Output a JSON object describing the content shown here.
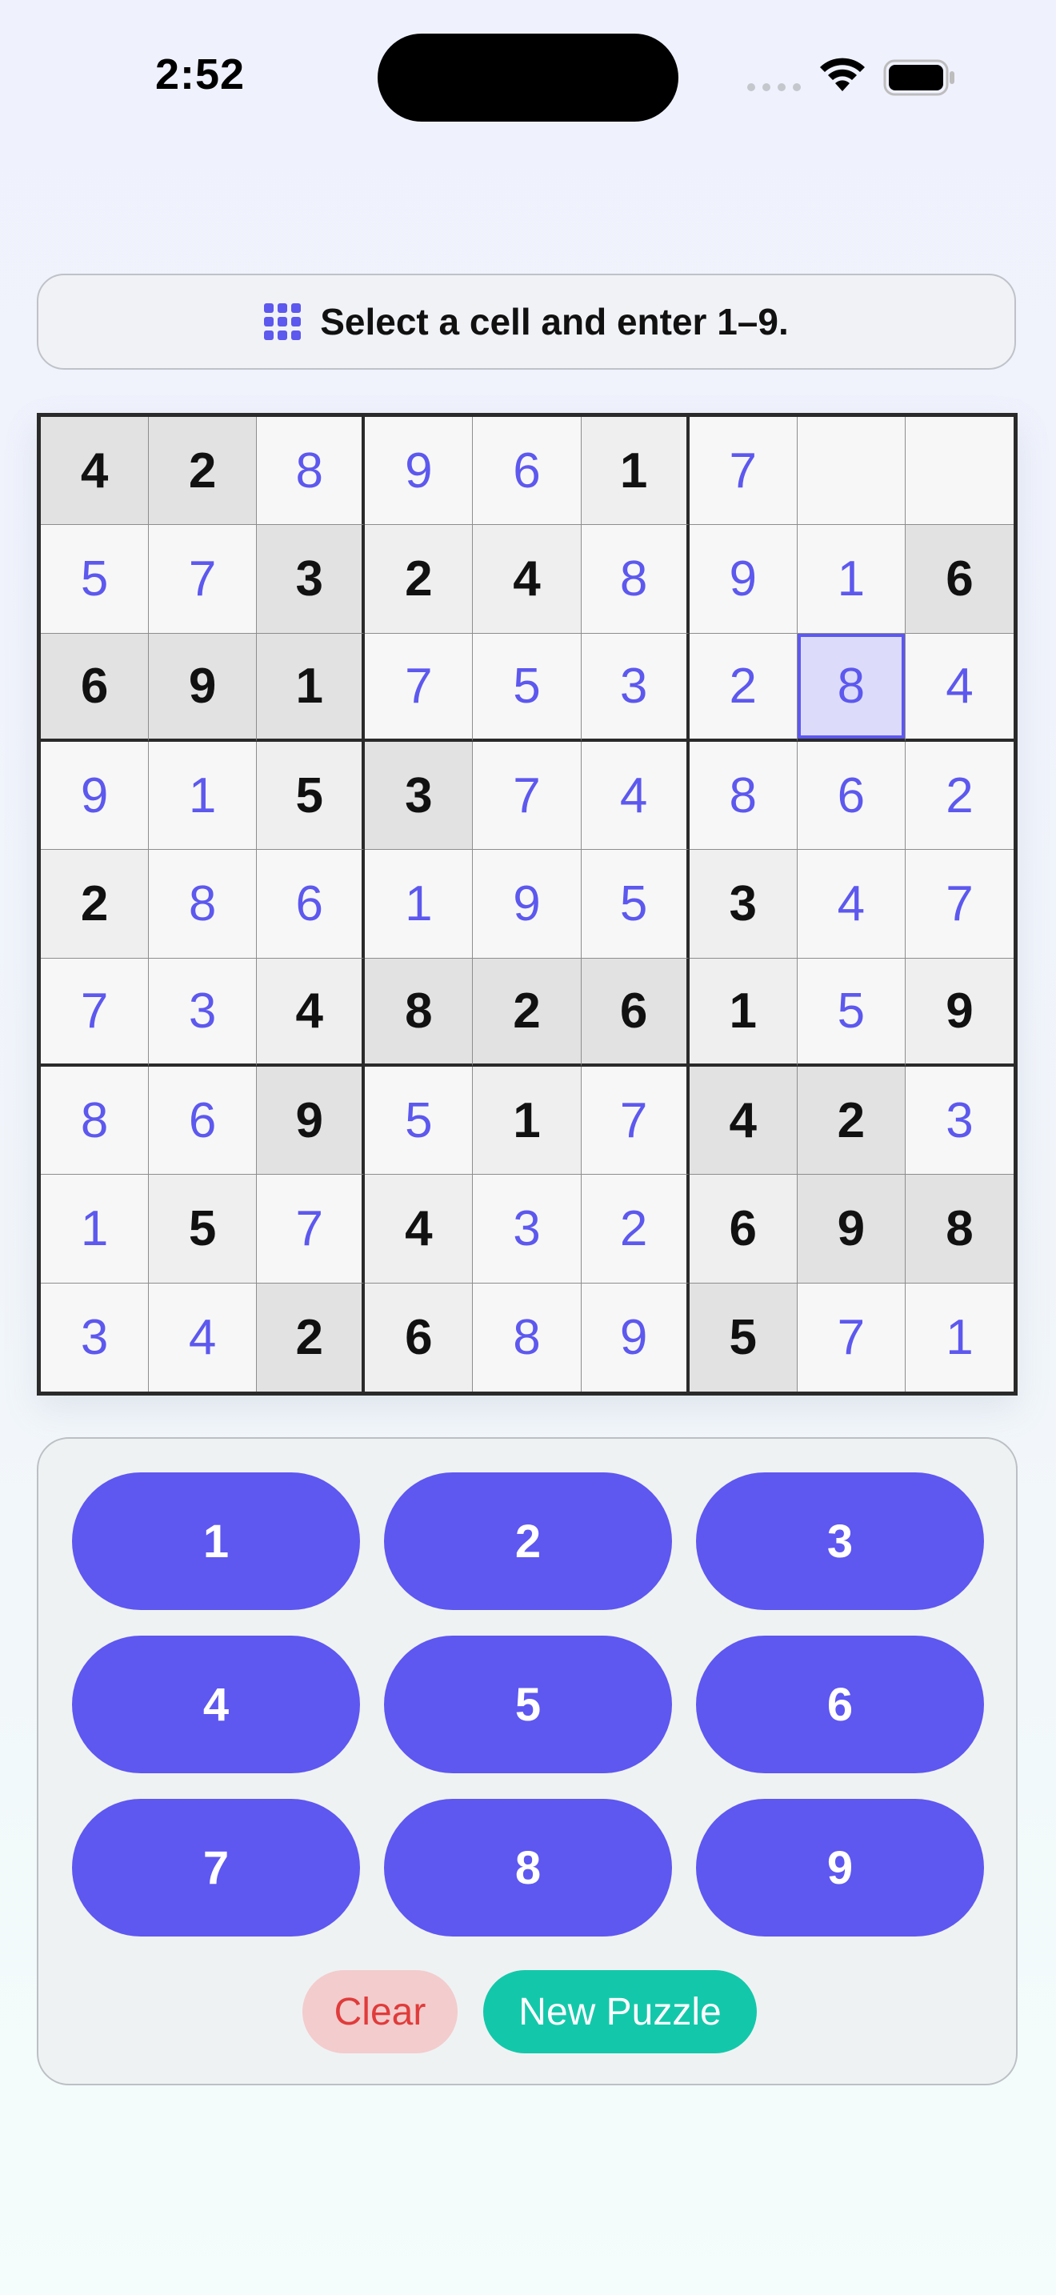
{
  "status_bar": {
    "time": "2:52"
  },
  "banner": {
    "icon": "grid-icon",
    "text": "Select a cell and enter 1–9."
  },
  "board": {
    "selected": [
      2,
      7
    ],
    "rows": [
      [
        {
          "v": "4",
          "g": true
        },
        {
          "v": "2",
          "g": true
        },
        {
          "v": "8",
          "g": false
        },
        {
          "v": "9",
          "g": false
        },
        {
          "v": "6",
          "g": false
        },
        {
          "v": "1",
          "g": true
        },
        {
          "v": "7",
          "g": false
        },
        {
          "v": "",
          "g": false
        },
        {
          "v": "",
          "g": false
        }
      ],
      [
        {
          "v": "5",
          "g": false
        },
        {
          "v": "7",
          "g": false
        },
        {
          "v": "3",
          "g": true
        },
        {
          "v": "2",
          "g": true
        },
        {
          "v": "4",
          "g": true
        },
        {
          "v": "8",
          "g": false
        },
        {
          "v": "9",
          "g": false
        },
        {
          "v": "1",
          "g": false
        },
        {
          "v": "6",
          "g": true
        }
      ],
      [
        {
          "v": "6",
          "g": true
        },
        {
          "v": "9",
          "g": true
        },
        {
          "v": "1",
          "g": true
        },
        {
          "v": "7",
          "g": false
        },
        {
          "v": "5",
          "g": false
        },
        {
          "v": "3",
          "g": false
        },
        {
          "v": "2",
          "g": false
        },
        {
          "v": "8",
          "g": false
        },
        {
          "v": "4",
          "g": false
        }
      ],
      [
        {
          "v": "9",
          "g": false
        },
        {
          "v": "1",
          "g": false
        },
        {
          "v": "5",
          "g": true
        },
        {
          "v": "3",
          "g": true
        },
        {
          "v": "7",
          "g": false
        },
        {
          "v": "4",
          "g": false
        },
        {
          "v": "8",
          "g": false
        },
        {
          "v": "6",
          "g": false
        },
        {
          "v": "2",
          "g": false
        }
      ],
      [
        {
          "v": "2",
          "g": true
        },
        {
          "v": "8",
          "g": false
        },
        {
          "v": "6",
          "g": false
        },
        {
          "v": "1",
          "g": false
        },
        {
          "v": "9",
          "g": false
        },
        {
          "v": "5",
          "g": false
        },
        {
          "v": "3",
          "g": true
        },
        {
          "v": "4",
          "g": false
        },
        {
          "v": "7",
          "g": false
        }
      ],
      [
        {
          "v": "7",
          "g": false
        },
        {
          "v": "3",
          "g": false
        },
        {
          "v": "4",
          "g": true
        },
        {
          "v": "8",
          "g": true
        },
        {
          "v": "2",
          "g": true
        },
        {
          "v": "6",
          "g": true
        },
        {
          "v": "1",
          "g": true
        },
        {
          "v": "5",
          "g": false
        },
        {
          "v": "9",
          "g": true
        }
      ],
      [
        {
          "v": "8",
          "g": false
        },
        {
          "v": "6",
          "g": false
        },
        {
          "v": "9",
          "g": true
        },
        {
          "v": "5",
          "g": false
        },
        {
          "v": "1",
          "g": true
        },
        {
          "v": "7",
          "g": false
        },
        {
          "v": "4",
          "g": true
        },
        {
          "v": "2",
          "g": true
        },
        {
          "v": "3",
          "g": false
        }
      ],
      [
        {
          "v": "1",
          "g": false
        },
        {
          "v": "5",
          "g": true
        },
        {
          "v": "7",
          "g": false
        },
        {
          "v": "4",
          "g": true
        },
        {
          "v": "3",
          "g": false
        },
        {
          "v": "2",
          "g": false
        },
        {
          "v": "6",
          "g": true
        },
        {
          "v": "9",
          "g": true
        },
        {
          "v": "8",
          "g": true
        }
      ],
      [
        {
          "v": "3",
          "g": false
        },
        {
          "v": "4",
          "g": false
        },
        {
          "v": "2",
          "g": true
        },
        {
          "v": "6",
          "g": true
        },
        {
          "v": "8",
          "g": false
        },
        {
          "v": "9",
          "g": false
        },
        {
          "v": "5",
          "g": true
        },
        {
          "v": "7",
          "g": false
        },
        {
          "v": "1",
          "g": false
        }
      ]
    ]
  },
  "keypad": {
    "keys": [
      "1",
      "2",
      "3",
      "4",
      "5",
      "6",
      "7",
      "8",
      "9"
    ],
    "clear_label": "Clear",
    "new_puzzle_label": "New Puzzle"
  },
  "colors": {
    "accent": "#5e57f0",
    "clear_bg": "#f3cccd",
    "clear_text": "#e03b3b",
    "new_puzzle_bg": "#13c8aa"
  }
}
